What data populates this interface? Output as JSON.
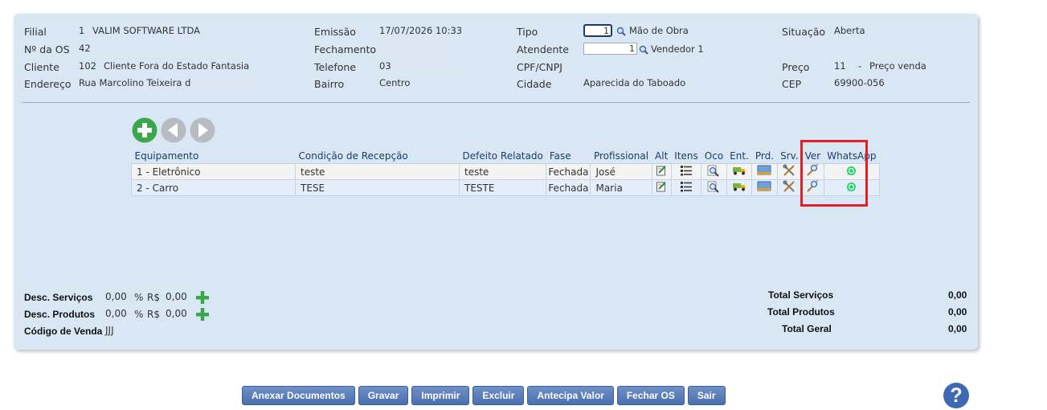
{
  "header": {
    "filial_label": "Filial",
    "filial_code": "1",
    "filial_name": "VALIM SOFTWARE LTDA",
    "os_label": "Nº da OS",
    "os_value": "42",
    "cliente_label": "Cliente",
    "cliente_code": "102",
    "cliente_name": "Cliente Fora do Estado Fantasia",
    "endereco_label": "Endereço",
    "endereco_value": "Rua Marcolino Teixeira de",
    "emissao_label": "Emissão",
    "emissao_value": "17/07/2026 10:33",
    "fechamento_label": "Fechamento",
    "telefone_label": "Telefone",
    "telefone_value": "03",
    "bairro_label": "Bairro",
    "bairro_value": "Centro",
    "tipo_label": "Tipo",
    "tipo_input": "1",
    "tipo_desc": "Mão de Obra",
    "atendente_label": "Atendente",
    "atendente_input": "1",
    "atendente_desc": "Vendedor 1",
    "cpf_label": "CPF/CNPJ",
    "cidade_label": "Cidade",
    "cidade_value": "Aparecida do Taboado",
    "situacao_label": "Situação",
    "situacao_value": "Aberta",
    "preco_label": "Preço",
    "preco_code": "11",
    "preco_sep": "-",
    "preco_desc": "Preço venda",
    "cep_label": "CEP",
    "cep_value": "69900-056"
  },
  "table": {
    "columns": [
      "Equipamento",
      "Condição de Recepção",
      "Defeito Relatado",
      "Fase",
      "Profissional",
      "Alt",
      "Itens",
      "Oco",
      "Ent.",
      "Prd.",
      "Srv.",
      "Ver",
      "WhatsApp"
    ],
    "rows": [
      {
        "equipamento": "1 - Eletrônico",
        "condicao": "teste",
        "defeito": "teste",
        "fase": "Fechada",
        "profissional": "José"
      },
      {
        "equipamento": "2 - Carro",
        "condicao": "TESE",
        "defeito": "TESTE",
        "fase": "Fechada",
        "profissional": "Maria"
      }
    ]
  },
  "icons": {
    "add": "add-circle-icon",
    "prev": "arrow-left-icon",
    "next": "arrow-right-icon",
    "alt": "edit-icon",
    "itens": "list-icon",
    "oco": "magnifier-icon",
    "ent": "truck-icon",
    "prd": "product-icon",
    "srv": "tools-icon",
    "ver": "inspect-icon",
    "whatsapp": "whatsapp-icon"
  },
  "footer": {
    "desc_servicos_label": "Desc. Serviços",
    "desc_servicos_pct": "0,00",
    "desc_servicos_pct_sign": "%",
    "desc_servicos_rs_sign": "R$",
    "desc_servicos_rs": "0,00",
    "desc_produtos_label": "Desc. Produtos",
    "desc_produtos_pct": "0,00",
    "desc_produtos_pct_sign": "%",
    "desc_produtos_rs_sign": "R$",
    "desc_produtos_rs": "0,00",
    "codigo_venda_label": "Código de Venda",
    "codigo_venda_value": "JJJ",
    "total_servicos_label": "Total Serviços",
    "total_servicos_value": "0,00",
    "total_produtos_label": "Total Produtos",
    "total_produtos_value": "0,00",
    "total_geral_label": "Total Geral",
    "total_geral_value": "0,00"
  },
  "buttons": {
    "anexar": "Anexar Documentos",
    "gravar": "Gravar",
    "imprimir": "Imprimir",
    "excluir": "Excluir",
    "antecipa": "Antecipa Valor",
    "fechar": "Fechar OS",
    "sair": "Sair",
    "help": "?"
  },
  "colors": {
    "panel_bg": "#d9e7f5",
    "button_blue": "#4a6fae",
    "add_green": "#3aa84a",
    "highlight_red": "#e31e24",
    "whatsapp_green": "#25d366"
  }
}
